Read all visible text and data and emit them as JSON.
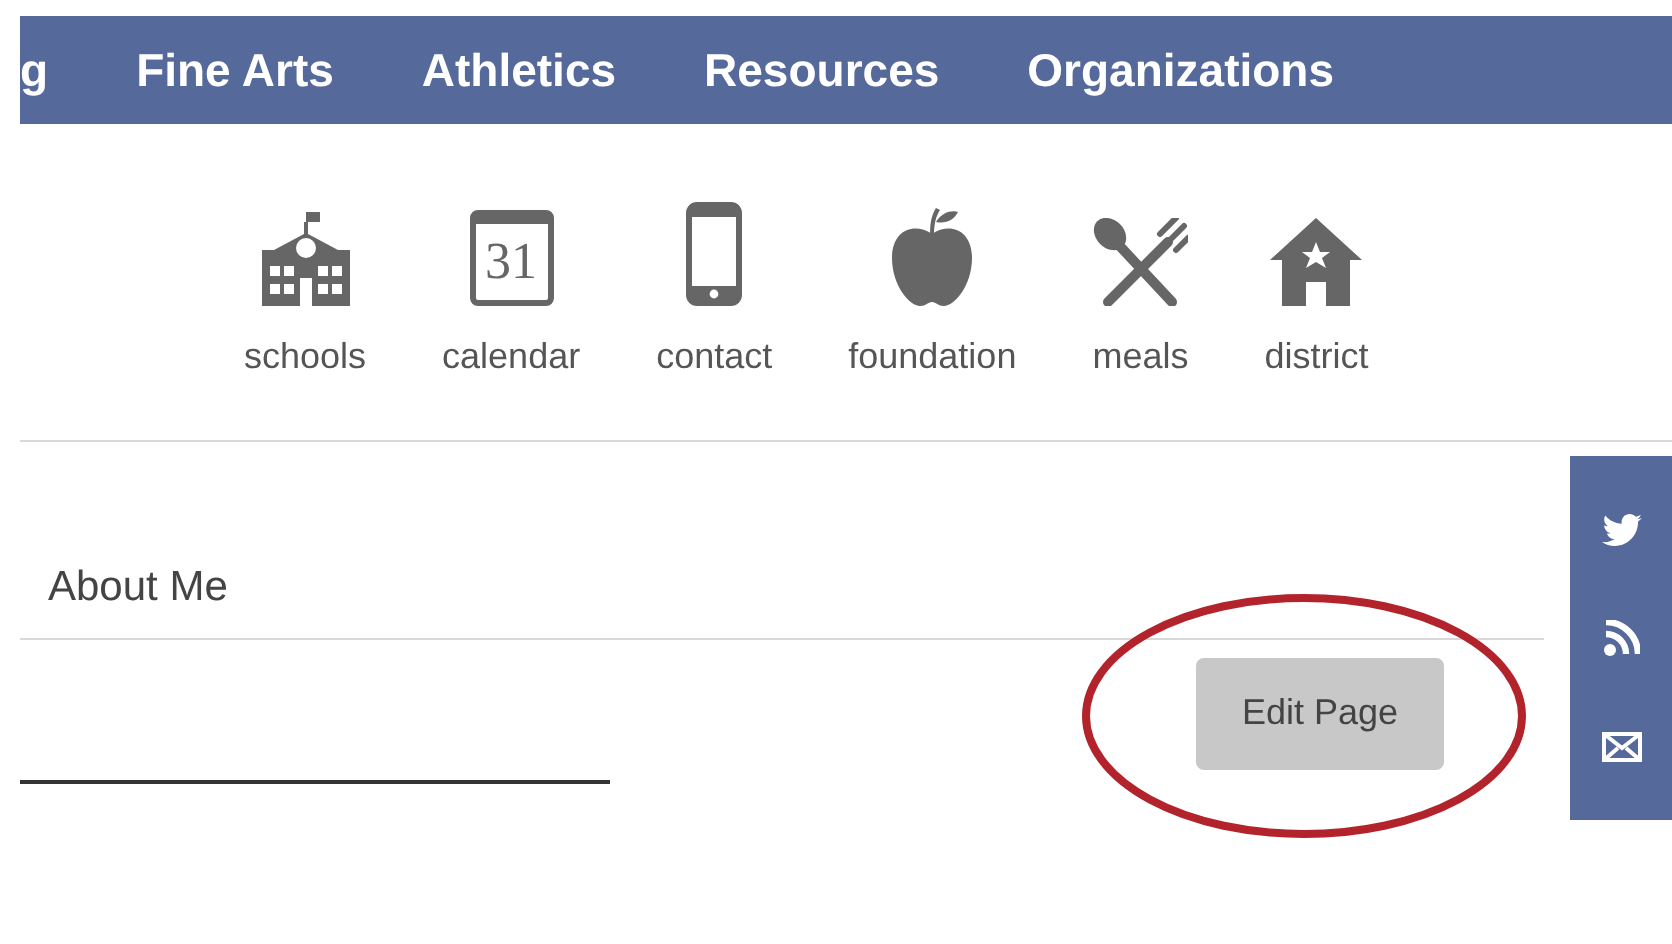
{
  "nav": {
    "items": [
      "g",
      "Fine Arts",
      "Athletics",
      "Resources",
      "Organizations"
    ]
  },
  "quick_links": [
    {
      "kind": "school",
      "label": "schools"
    },
    {
      "kind": "calendar",
      "label": "calendar",
      "icon_text": "31"
    },
    {
      "kind": "phone",
      "label": "contact"
    },
    {
      "kind": "apple",
      "label": "foundation"
    },
    {
      "kind": "utensils",
      "label": "meals"
    },
    {
      "kind": "house",
      "label": "district"
    }
  ],
  "social": [
    {
      "kind": "twitter"
    },
    {
      "kind": "rss"
    },
    {
      "kind": "mail"
    }
  ],
  "section": {
    "title": "About Me"
  },
  "edit_button": {
    "label": "Edit Page",
    "highlighted": true
  }
}
